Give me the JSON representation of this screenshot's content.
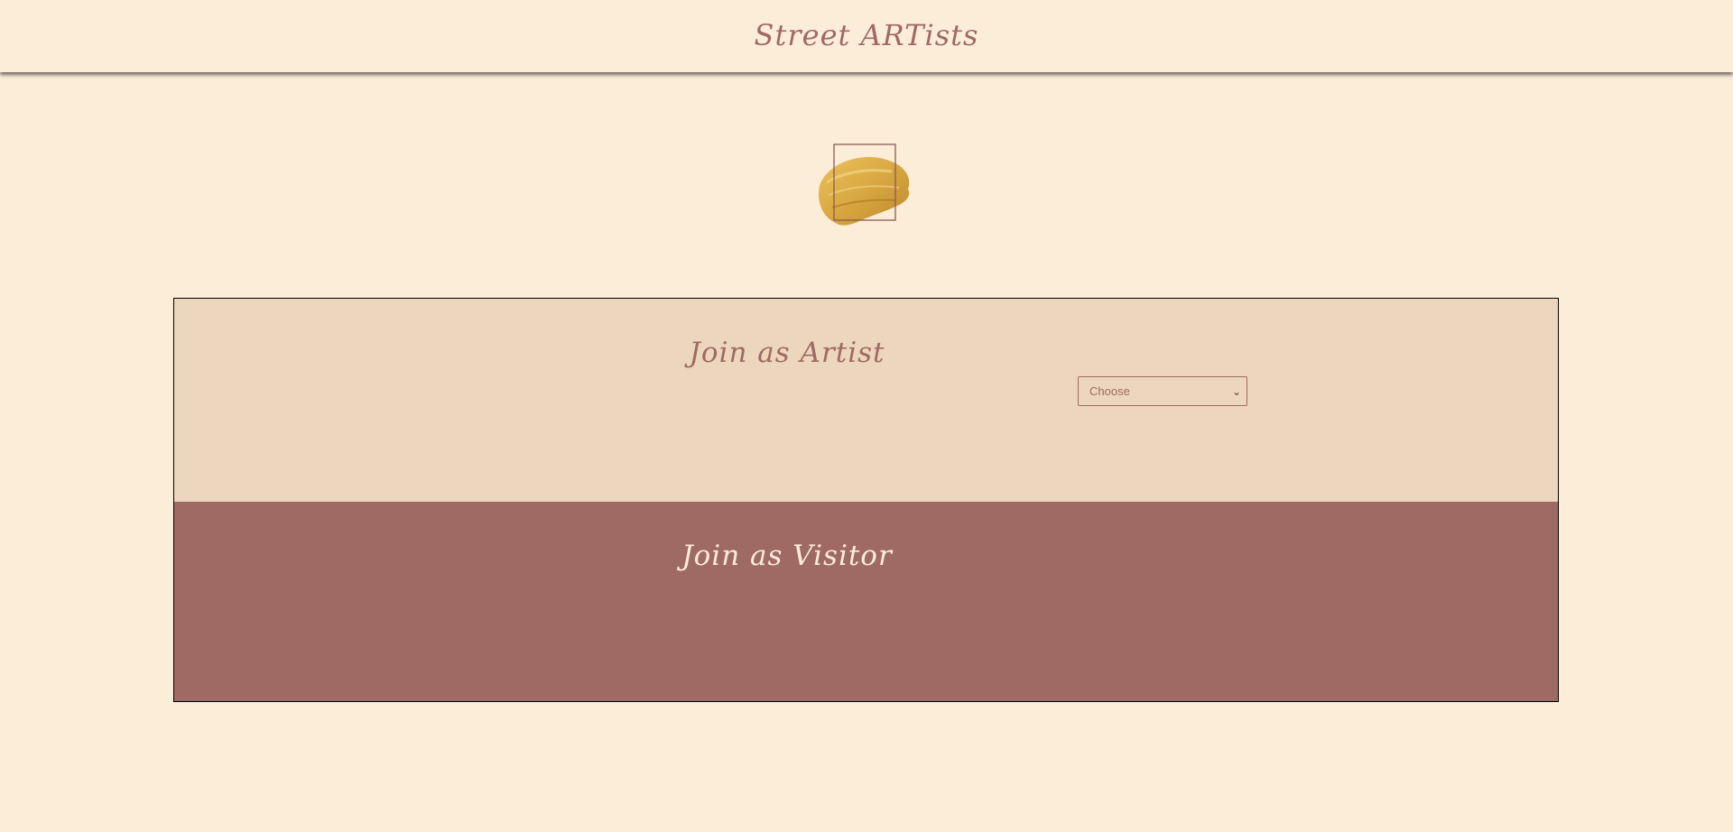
{
  "header": {
    "title": "Street ARTists"
  },
  "logo": {
    "icon": "gold-paint-brush-stroke",
    "paint_color": "#d7a43a",
    "frame_color": "#9f6a63"
  },
  "join_artist": {
    "heading": "Join as Artist",
    "select": {
      "selected": "Choose"
    }
  },
  "join_visitor": {
    "heading": "Join as Visitor"
  },
  "colors": {
    "background": "#fcedd9",
    "artist_panel": "#ecd6bd",
    "visitor_panel": "#9f6a63",
    "accent_text": "#9f6a63"
  }
}
